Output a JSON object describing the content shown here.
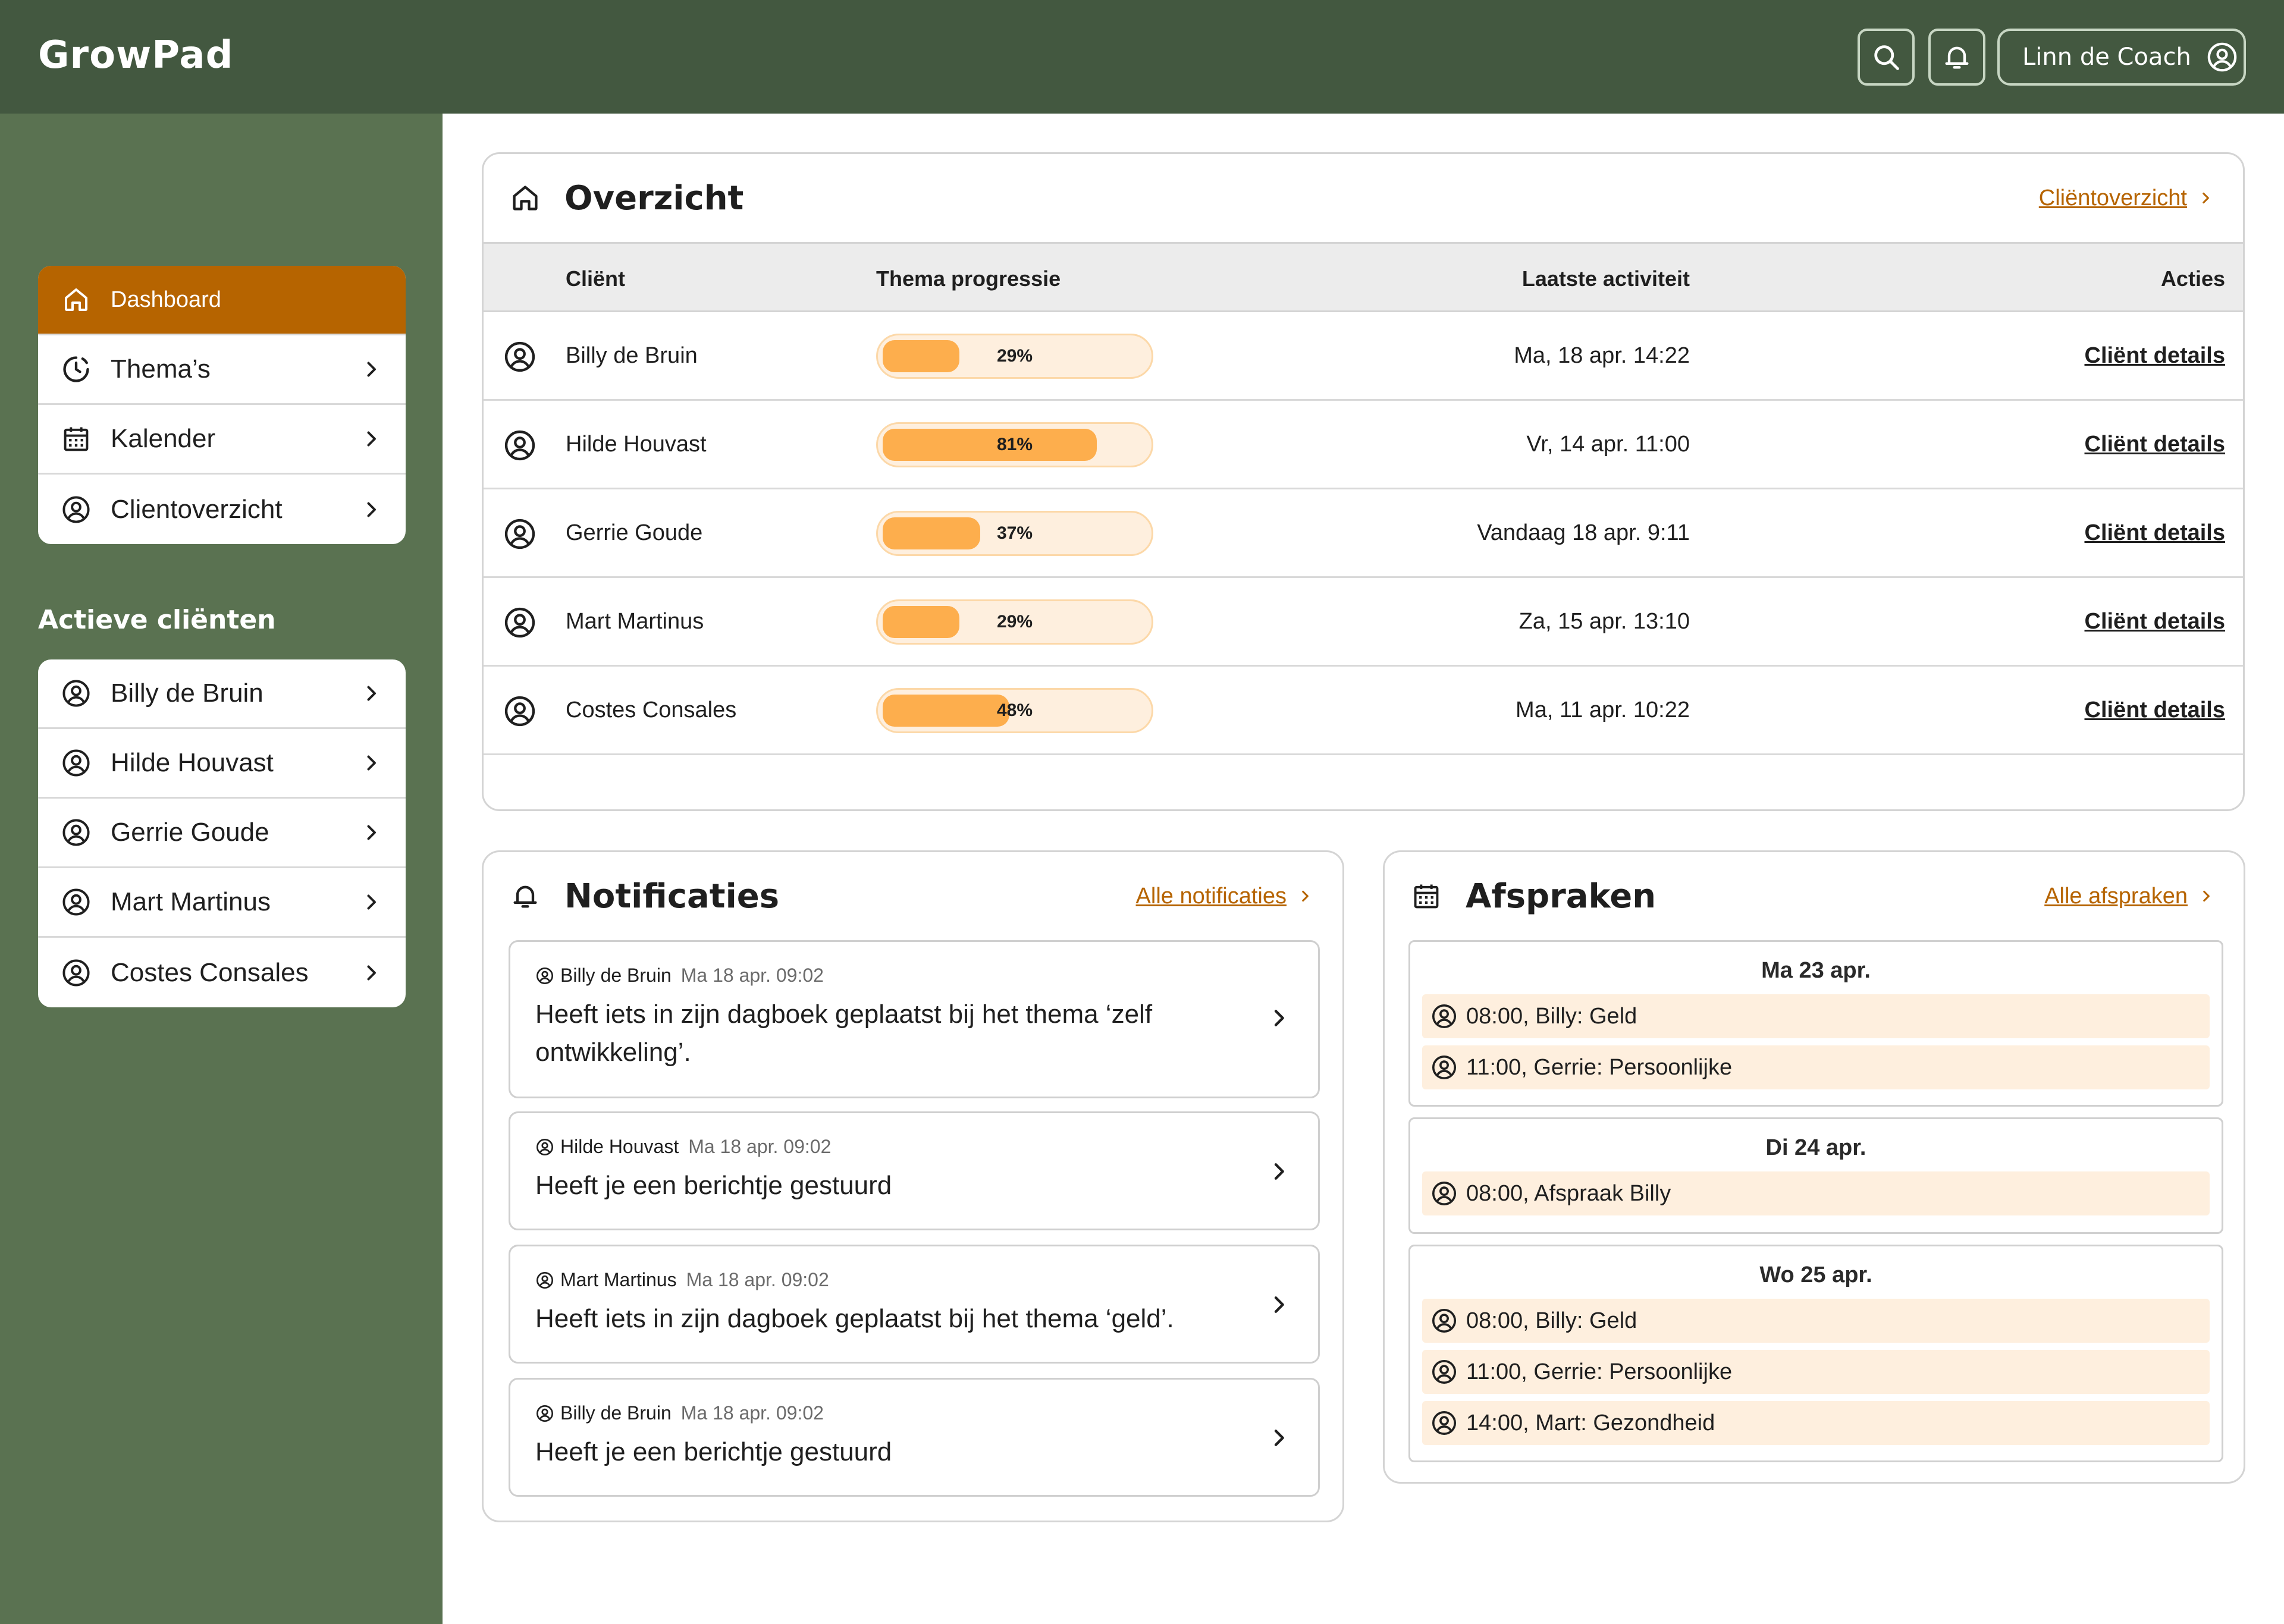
{
  "app": {
    "name": "GrowPad"
  },
  "header": {
    "search_icon": "search-icon",
    "bell_icon": "bell-icon",
    "user_label": "Linn de Coach"
  },
  "sidebar": {
    "nav": [
      {
        "label": "Dashboard",
        "icon": "home-icon",
        "active": true
      },
      {
        "label": "Thema’s",
        "icon": "progress-icon"
      },
      {
        "label": "Kalender",
        "icon": "calendar-icon"
      },
      {
        "label": "Clientoverzicht",
        "icon": "user-circle-icon"
      }
    ],
    "clients_heading": "Actieve cliënten",
    "clients": [
      {
        "label": "Billy de Bruin"
      },
      {
        "label": "Hilde Houvast"
      },
      {
        "label": "Gerrie Goude"
      },
      {
        "label": "Mart Martinus"
      },
      {
        "label": "Costes Consales"
      }
    ]
  },
  "overview": {
    "title": "Overzicht",
    "link": "Cliëntoverzicht",
    "columns": {
      "client": "Cliënt",
      "progress": "Thema progressie",
      "activity": "Laatste activiteit",
      "actions": "Acties"
    },
    "rows": [
      {
        "name": "Billy de Bruin",
        "progress": 29,
        "progress_label": "29%",
        "activity": "Ma, 18 apr. 14:22",
        "action": "Cliënt details"
      },
      {
        "name": "Hilde Houvast",
        "progress": 81,
        "progress_label": "81%",
        "activity": "Vr, 14 apr. 11:00",
        "action": "Cliënt details"
      },
      {
        "name": "Gerrie Goude",
        "progress": 37,
        "progress_label": "37%",
        "activity": "Vandaag 18 apr. 9:11",
        "action": "Cliënt details"
      },
      {
        "name": "Mart Martinus",
        "progress": 29,
        "progress_label": "29%",
        "activity": "Za, 15 apr. 13:10",
        "action": "Cliënt details"
      },
      {
        "name": "Costes Consales",
        "progress": 48,
        "progress_label": "48%",
        "activity": "Ma, 11 apr. 10:22",
        "action": "Cliënt details"
      }
    ]
  },
  "notifications": {
    "title": "Notificaties",
    "link": "Alle notificaties",
    "items": [
      {
        "who": "Billy de Bruin",
        "when": "Ma 18 apr. 09:02",
        "message": "Heeft iets in zijn dagboek geplaatst bij het thema ‘zelf ontwikkeling’."
      },
      {
        "who": "Hilde Houvast",
        "when": "Ma 18 apr. 09:02",
        "message": "Heeft je een berichtje gestuurd"
      },
      {
        "who": "Mart Martinus",
        "when": "Ma 18 apr. 09:02",
        "message": "Heeft iets in zijn dagboek geplaatst bij het thema ‘geld’."
      },
      {
        "who": "Billy de Bruin",
        "when": "Ma 18 apr. 09:02",
        "message": "Heeft je een berichtje gestuurd"
      }
    ]
  },
  "appointments": {
    "title": "Afspraken",
    "link": "Alle afspraken",
    "days": [
      {
        "date": "Ma 23 apr.",
        "items": [
          "08:00, Billy: Geld",
          "11:00, Gerrie: Persoonlijke"
        ]
      },
      {
        "date": "Di 24 apr.",
        "items": [
          "08:00, Afspraak Billy"
        ]
      },
      {
        "date": "Wo 25 apr.",
        "items": [
          "08:00, Billy: Geld",
          "11:00, Gerrie: Persoonlijke",
          "14:00, Mart: Gezondheid"
        ]
      }
    ]
  },
  "colors": {
    "header_bg": "#435840",
    "sidebar_bg": "#5a7251",
    "accent": "#b66400",
    "progress_fill": "#fdae4d",
    "progress_track": "#feefde"
  }
}
